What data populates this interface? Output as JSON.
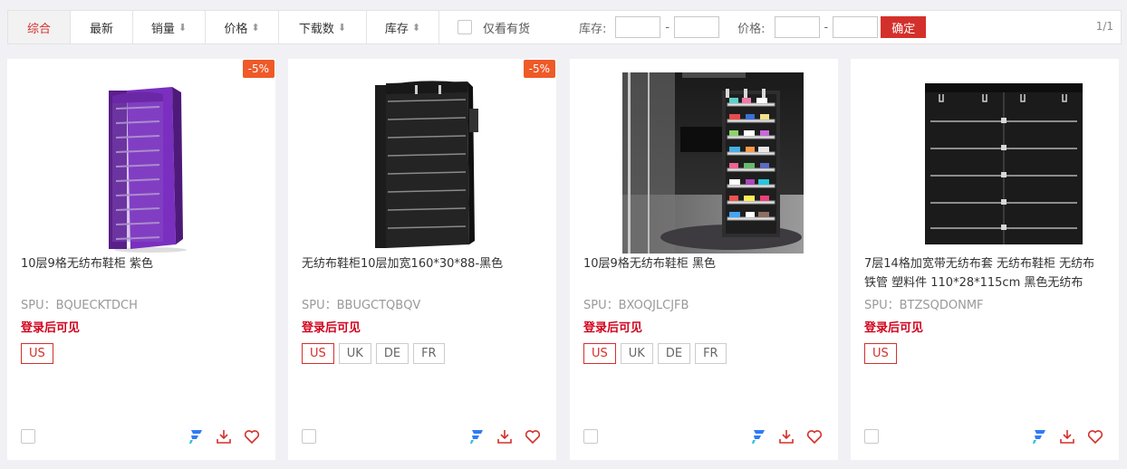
{
  "sort_bar": {
    "tabs": [
      {
        "label": "综合",
        "arrow": ""
      },
      {
        "label": "最新",
        "arrow": ""
      },
      {
        "label": "销量",
        "arrow": "⬇"
      },
      {
        "label": "价格",
        "arrow": "⬍"
      },
      {
        "label": "下载数",
        "arrow": "⬇"
      },
      {
        "label": "库存",
        "arrow": "⬍"
      }
    ],
    "in_stock_label": "仅看有货",
    "stock_label": "库存:",
    "stock_min": "",
    "stock_max": "",
    "price_label": "价格:",
    "price_min": "",
    "price_max": "",
    "range_dash": "-",
    "confirm_label": "确定",
    "page_indicator": "1/1"
  },
  "colors": {
    "accent": "#d4302b",
    "discount": "#ee5a28",
    "login_tip": "#d0021b"
  },
  "products": [
    {
      "discount": "-5%",
      "title": "10层9格无纺布鞋柜 紫色",
      "spu": "SPU：BQUECKTDCH",
      "login_tip": "登录后可见",
      "sites": [
        "US"
      ],
      "image": "purple-shoe-rack"
    },
    {
      "discount": "-5%",
      "title": "无纺布鞋柜10层加宽160*30*88-黑色",
      "spu": "SPU：BBUGCTQBQV",
      "login_tip": "登录后可见",
      "sites": [
        "US",
        "UK",
        "DE",
        "FR"
      ],
      "image": "black-shoe-rack-wide"
    },
    {
      "discount": "",
      "title": "10层9格无纺布鞋柜 黑色",
      "spu": "SPU：BXOQJLCJFB",
      "login_tip": "登录后可见",
      "sites": [
        "US",
        "UK",
        "DE",
        "FR"
      ],
      "image": "black-shoe-rack-room"
    },
    {
      "discount": "",
      "title": "7层14格加宽带无纺布套 无纺布鞋柜 无纺布 铁管 塑料件 110*28*115cm 黑色无纺布",
      "spu": "SPU：BTZSQDONMF",
      "login_tip": "登录后可见",
      "sites": [
        "US"
      ],
      "image": "black-shoe-rack-7tier"
    }
  ]
}
